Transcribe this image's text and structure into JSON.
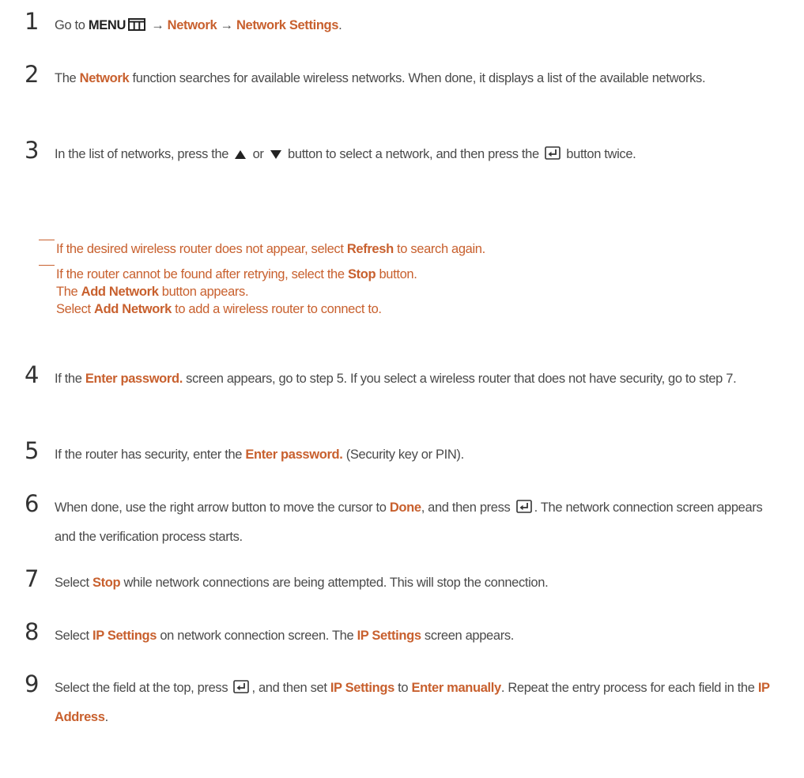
{
  "steps": [
    {
      "number": "1",
      "parts": [
        {
          "t": "Go to "
        },
        {
          "t": "MENU",
          "b": true
        },
        {
          "icon": "menu-grid-icon"
        },
        {
          "t": " → "
        },
        {
          "t": "Network",
          "h": true
        },
        {
          "t": " → "
        },
        {
          "t": "Network Settings",
          "h": true
        },
        {
          "t": "."
        }
      ]
    },
    {
      "number": "2",
      "parts": [
        {
          "t": "The "
        },
        {
          "t": "Network",
          "h": true
        },
        {
          "t": " function searches for available wireless networks. When done, it displays a list of the available networks."
        }
      ]
    },
    {
      "number": "3",
      "parts": [
        {
          "t": "In the list of networks, press the "
        },
        {
          "icon": "up-triangle-icon"
        },
        {
          "t": " or "
        },
        {
          "icon": "down-triangle-icon"
        },
        {
          "t": " button to select a network, and then press the "
        },
        {
          "icon": "enter-icon"
        },
        {
          "t": " button twice."
        }
      ],
      "notes": [
        {
          "parts": [
            {
              "t": "If the desired wireless router does not appear, select "
            },
            {
              "t": "Refresh",
              "h": true
            },
            {
              "t": " to search again."
            }
          ]
        },
        {
          "parts": [
            {
              "t": "If the router cannot be found after retrying, select the "
            },
            {
              "t": "Stop",
              "h": true
            },
            {
              "t": " button."
            }
          ],
          "extra": [
            [
              {
                "t": "The "
              },
              {
                "t": "Add Network",
                "h": true
              },
              {
                "t": " button appears."
              }
            ],
            [
              {
                "t": "Select "
              },
              {
                "t": "Add Network",
                "h": true
              },
              {
                "t": " to add a wireless router to connect to."
              }
            ]
          ]
        }
      ]
    },
    {
      "number": "4",
      "parts": [
        {
          "t": "If the "
        },
        {
          "t": "Enter password.",
          "h": true
        },
        {
          "t": " screen appears, go to step 5. If you select a wireless router that does not have security, go to step 7."
        }
      ]
    },
    {
      "number": "5",
      "parts": [
        {
          "t": "If the router has security, enter the "
        },
        {
          "t": "Enter password.",
          "h": true
        },
        {
          "t": " (Security key or PIN)."
        }
      ]
    },
    {
      "number": "6",
      "parts": [
        {
          "t": "When done, use the right arrow button to move the cursor to "
        },
        {
          "t": "Done",
          "h": true
        },
        {
          "t": ", and then press "
        },
        {
          "icon": "enter-icon"
        },
        {
          "t": ". The network connection screen appears and the verification process starts."
        }
      ]
    },
    {
      "number": "7",
      "parts": [
        {
          "t": "Select "
        },
        {
          "t": "Stop",
          "h": true
        },
        {
          "t": " while network connections are being attempted. This will stop the connection."
        }
      ]
    },
    {
      "number": "8",
      "parts": [
        {
          "t": "Select "
        },
        {
          "t": "IP Settings",
          "h": true
        },
        {
          "t": " on network connection screen. The "
        },
        {
          "t": "IP Settings",
          "h": true
        },
        {
          "t": " screen appears."
        }
      ]
    },
    {
      "number": "9",
      "parts": [
        {
          "t": "Select the field at the top, press "
        },
        {
          "icon": "enter-icon"
        },
        {
          "t": ", and then set "
        },
        {
          "t": "IP Settings",
          "h": true
        },
        {
          "t": " to "
        },
        {
          "t": "Enter manually",
          "h": true
        },
        {
          "t": ". Repeat the entry process for each field in the "
        },
        {
          "t": "IP Address",
          "h": true
        },
        {
          "t": "."
        }
      ]
    }
  ],
  "colors": {
    "accent": "#c8602e",
    "text": "#4a4a4a",
    "number": "#333333"
  }
}
